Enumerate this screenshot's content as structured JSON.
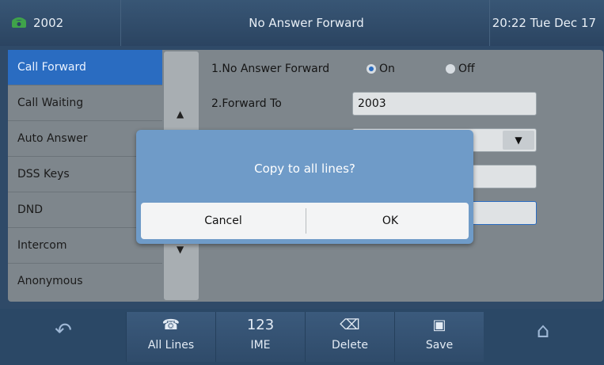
{
  "status_bar": {
    "line_number": "2002",
    "title": "No Answer Forward",
    "datetime": "20:22 Tue Dec 17"
  },
  "sidebar": {
    "items": [
      {
        "label": "Call Forward",
        "active": true
      },
      {
        "label": "Call Waiting"
      },
      {
        "label": "Auto Answer"
      },
      {
        "label": "DSS Keys"
      },
      {
        "label": "DND"
      },
      {
        "label": "Intercom"
      },
      {
        "label": "Anonymous"
      }
    ]
  },
  "form": {
    "row1_label": "1.No Answer Forward",
    "on_label": "On",
    "off_label": "Off",
    "selected": "On",
    "row2_label": "2.Forward To",
    "forward_to_value": "2003"
  },
  "dialog": {
    "message": "Copy to all lines?",
    "cancel_label": "Cancel",
    "ok_label": "OK"
  },
  "softkeys": {
    "all_lines_label": "All Lines",
    "ime_icon_text": "123",
    "ime_label": "IME",
    "delete_label": "Delete",
    "save_label": "Save"
  },
  "icons": {
    "back": "back-arrow-icon",
    "phone": "phone-icon",
    "delete": "backspace-icon",
    "save": "floppy-disk-icon",
    "home": "home-icon"
  },
  "colors": {
    "accent": "#2a6cc1",
    "dialog": "#6f9bc8"
  }
}
